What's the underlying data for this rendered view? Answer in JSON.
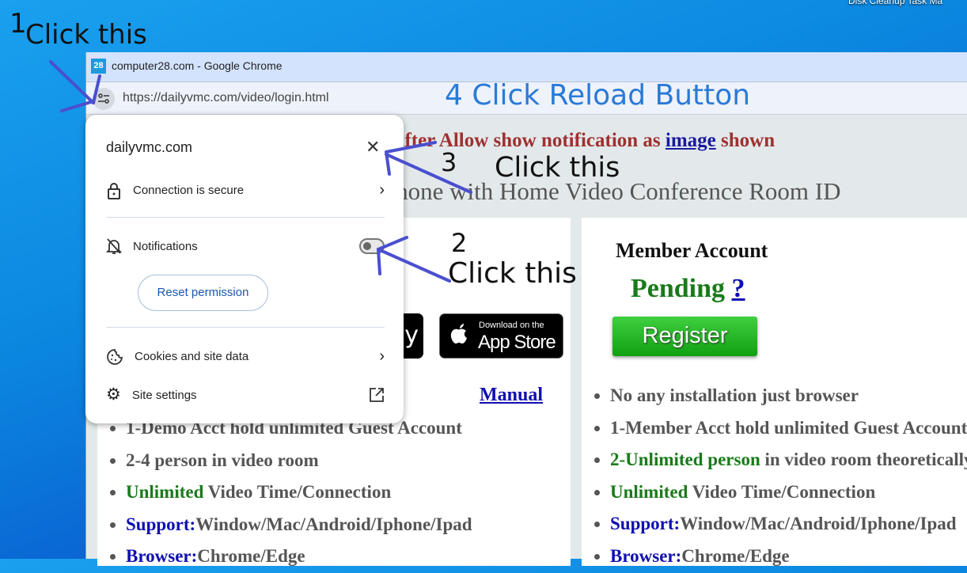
{
  "desktop": {
    "taskbar_labels": "Disk Cleanup  Task Ma"
  },
  "window": {
    "favicon_text": "28",
    "title": "computer28.com - Google Chrome"
  },
  "address_bar": {
    "url": "https://dailyvmc.com/video/login.html"
  },
  "page": {
    "header_line1_prefix": "after Allow show notification as ",
    "header_line1_link": "image",
    "header_line1_suffix": " shown",
    "header_line2": "ate Phone with Home Video Conference Room ID",
    "manual_link": "Manual",
    "app_store": {
      "small": "Download on the",
      "big": "App Store"
    },
    "google_play_partial": "y",
    "left_list": [
      {
        "plain": "1-Demo Acct hold unlimited Guest Account"
      },
      {
        "plain": "2-4 person in video room"
      },
      {
        "green": "Unlimited",
        "plain": " Video Time/Connection"
      },
      {
        "blue": "Support:",
        "plain": "Window/Mac/Android/Iphone/Ipad"
      },
      {
        "blue": "Browser:",
        "plain": "Chrome/Edge"
      }
    ],
    "member": {
      "title": "Member Account",
      "status": "Pending",
      "help_link": "?",
      "register_button": "Register",
      "list": [
        {
          "plain": "No any installation just browser"
        },
        {
          "plain": "1-Member Acct hold unlimited Guest Account"
        },
        {
          "green": "2-Unlimited person",
          "plain": " in video room theoretically"
        },
        {
          "green": "Unlimited",
          "plain": " Video Time/Connection"
        },
        {
          "blue": "Support:",
          "plain": "Window/Mac/Android/Iphone/Ipad"
        },
        {
          "blue": "Browser:",
          "plain": "Chrome/Edge"
        }
      ]
    }
  },
  "site_info_popup": {
    "domain": "dailyvmc.com",
    "connection": "Connection is secure",
    "notifications": "Notifications",
    "notifications_enabled": false,
    "reset_permission": "Reset permission",
    "cookies": "Cookies and site data",
    "site_settings": "Site settings"
  },
  "annotations": {
    "step1_num": "1",
    "step1_text": "Click this",
    "step2_num": "2",
    "step2_text": "Click this",
    "step3_num": "3",
    "step3_text": "Click this",
    "step4_text": "4 Click Reload Button",
    "stroke_color": "#4a4fd0"
  }
}
